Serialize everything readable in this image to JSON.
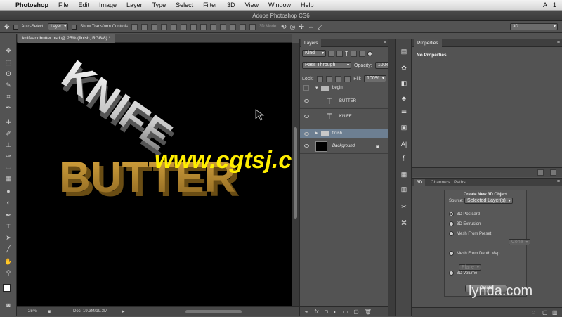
{
  "menubar": {
    "app": "Photoshop",
    "items": [
      "File",
      "Edit",
      "Image",
      "Layer",
      "Type",
      "Select",
      "Filter",
      "3D",
      "View",
      "Window",
      "Help"
    ],
    "right": [
      "A",
      "1"
    ]
  },
  "window": {
    "title": "Adobe Photoshop CS6"
  },
  "options": {
    "auto_select": "Auto-Select:",
    "auto_select_value": "Layer",
    "transform": "Show Transform Controls",
    "mode3d": "3D Mode:",
    "workspace": "3D"
  },
  "document": {
    "tab": "knifeandbutter.psd @ 25% (finish, RGB/8) *",
    "zoom": "25%",
    "doc_size": "Doc: 19.3M/19.3M",
    "art_text_1": "KNIFE",
    "art_text_2": "BUTTER",
    "watermark": "www.cgtsj.com"
  },
  "layers_panel": {
    "tab": "Layers",
    "kind": "Kind",
    "blend": "Pass Through",
    "opacity_label": "Opacity:",
    "opacity": "100%",
    "lock_label": "Lock:",
    "fill_label": "Fill:",
    "fill": "100%",
    "layers": [
      {
        "name": "begin",
        "type": "group"
      },
      {
        "name": "BUTTER",
        "type": "text"
      },
      {
        "name": "KNIFE",
        "type": "text"
      },
      {
        "name": "finish",
        "type": "group"
      },
      {
        "name": "Background",
        "type": "image"
      }
    ]
  },
  "properties_panel": {
    "tab": "Properties",
    "empty": "No Properties"
  },
  "threed_panel": {
    "tabs": [
      "3D",
      "Channels",
      "Paths"
    ],
    "heading": "Create New 3D Object",
    "source_label": "Source:",
    "source_value": "Selected Layer(s)",
    "options": [
      "3D Postcard",
      "3D Extrusion",
      "Mesh From Preset",
      "Mesh From Depth Map",
      "3D Volume"
    ],
    "preset_value": "Cone",
    "depth_value": "Plane",
    "create": "Create"
  },
  "watermark_brand": "lynda.com"
}
